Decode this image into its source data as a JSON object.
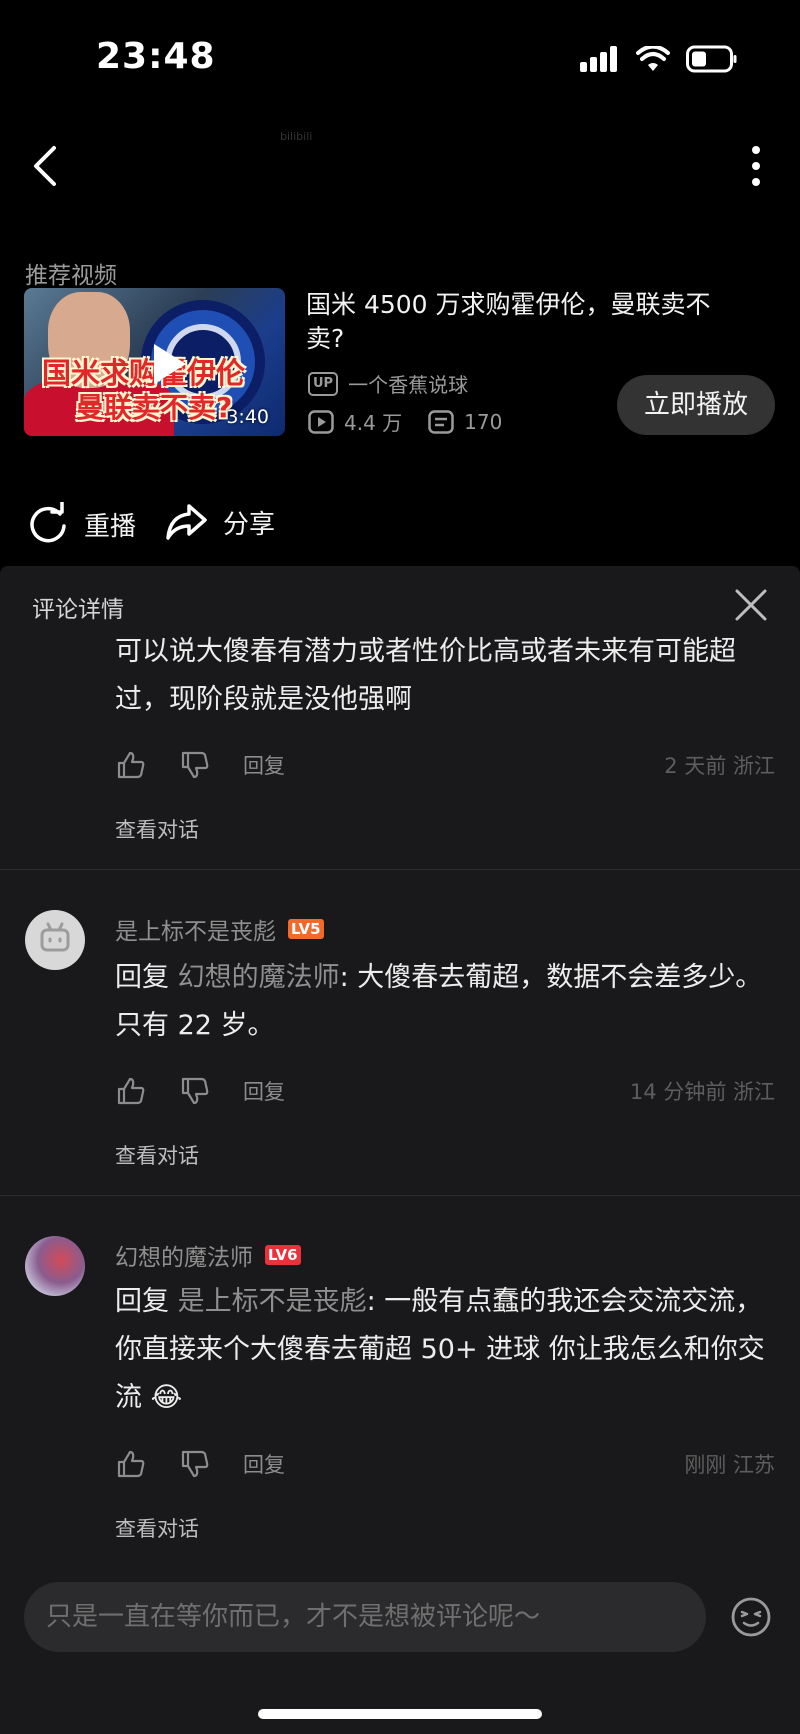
{
  "status_bar": {
    "time": "23:48"
  },
  "watermark": "bilibili",
  "recommend": {
    "header": "推荐视频",
    "thumb_caption_1": "国米求购霍伊伦",
    "thumb_caption_2": "曼联卖不卖?",
    "duration": "3:40",
    "title": "国米 4500 万求购霍伊伦，曼联卖不卖?",
    "up_badge": "UP",
    "uploader": "一个香蕉说球",
    "views": "4.4 万",
    "danmaku": "170",
    "play_now": "立即播放"
  },
  "actions": {
    "replay": "重播",
    "share": "分享"
  },
  "panel": {
    "title": "评论详情"
  },
  "comments": [
    {
      "text": "可以说大傻春有潜力或者性价比高或者未来有可能超过，现阶段就是没他强啊",
      "reply_label": "回复",
      "meta": "2 天前  浙江",
      "view_conversation": "查看对话"
    },
    {
      "username": "是上标不是丧彪",
      "level": "LV5",
      "level_color": "#f26a2b",
      "reply_prefix": "回复",
      "mention": "幻想的魔法师",
      "text": ": 大傻春去葡超，数据不会差多少。只有 22 岁。",
      "reply_label": "回复",
      "meta": "14 分钟前  浙江",
      "view_conversation": "查看对话"
    },
    {
      "username": "幻想的魔法师",
      "level": "LV6",
      "level_color": "#e8323c",
      "reply_prefix": "回复",
      "mention": "是上标不是丧彪",
      "text": ": 一般有点蠢的我还会交流交流，你直接来个大傻春去葡超 50+ 进球 你让我怎么和你交流",
      "emoji": "😂",
      "reply_label": "回复",
      "meta": "刚刚  江苏",
      "view_conversation": "查看对话"
    }
  ],
  "input": {
    "placeholder": "只是一直在等你而已，才不是想被评论呢～"
  },
  "icons": [
    "back-icon",
    "more-icon",
    "play-icon",
    "up-icon",
    "views-icon",
    "danmaku-icon",
    "replay-icon",
    "share-icon",
    "close-icon",
    "thumb-up-icon",
    "thumb-down-icon",
    "emoji-icon"
  ]
}
